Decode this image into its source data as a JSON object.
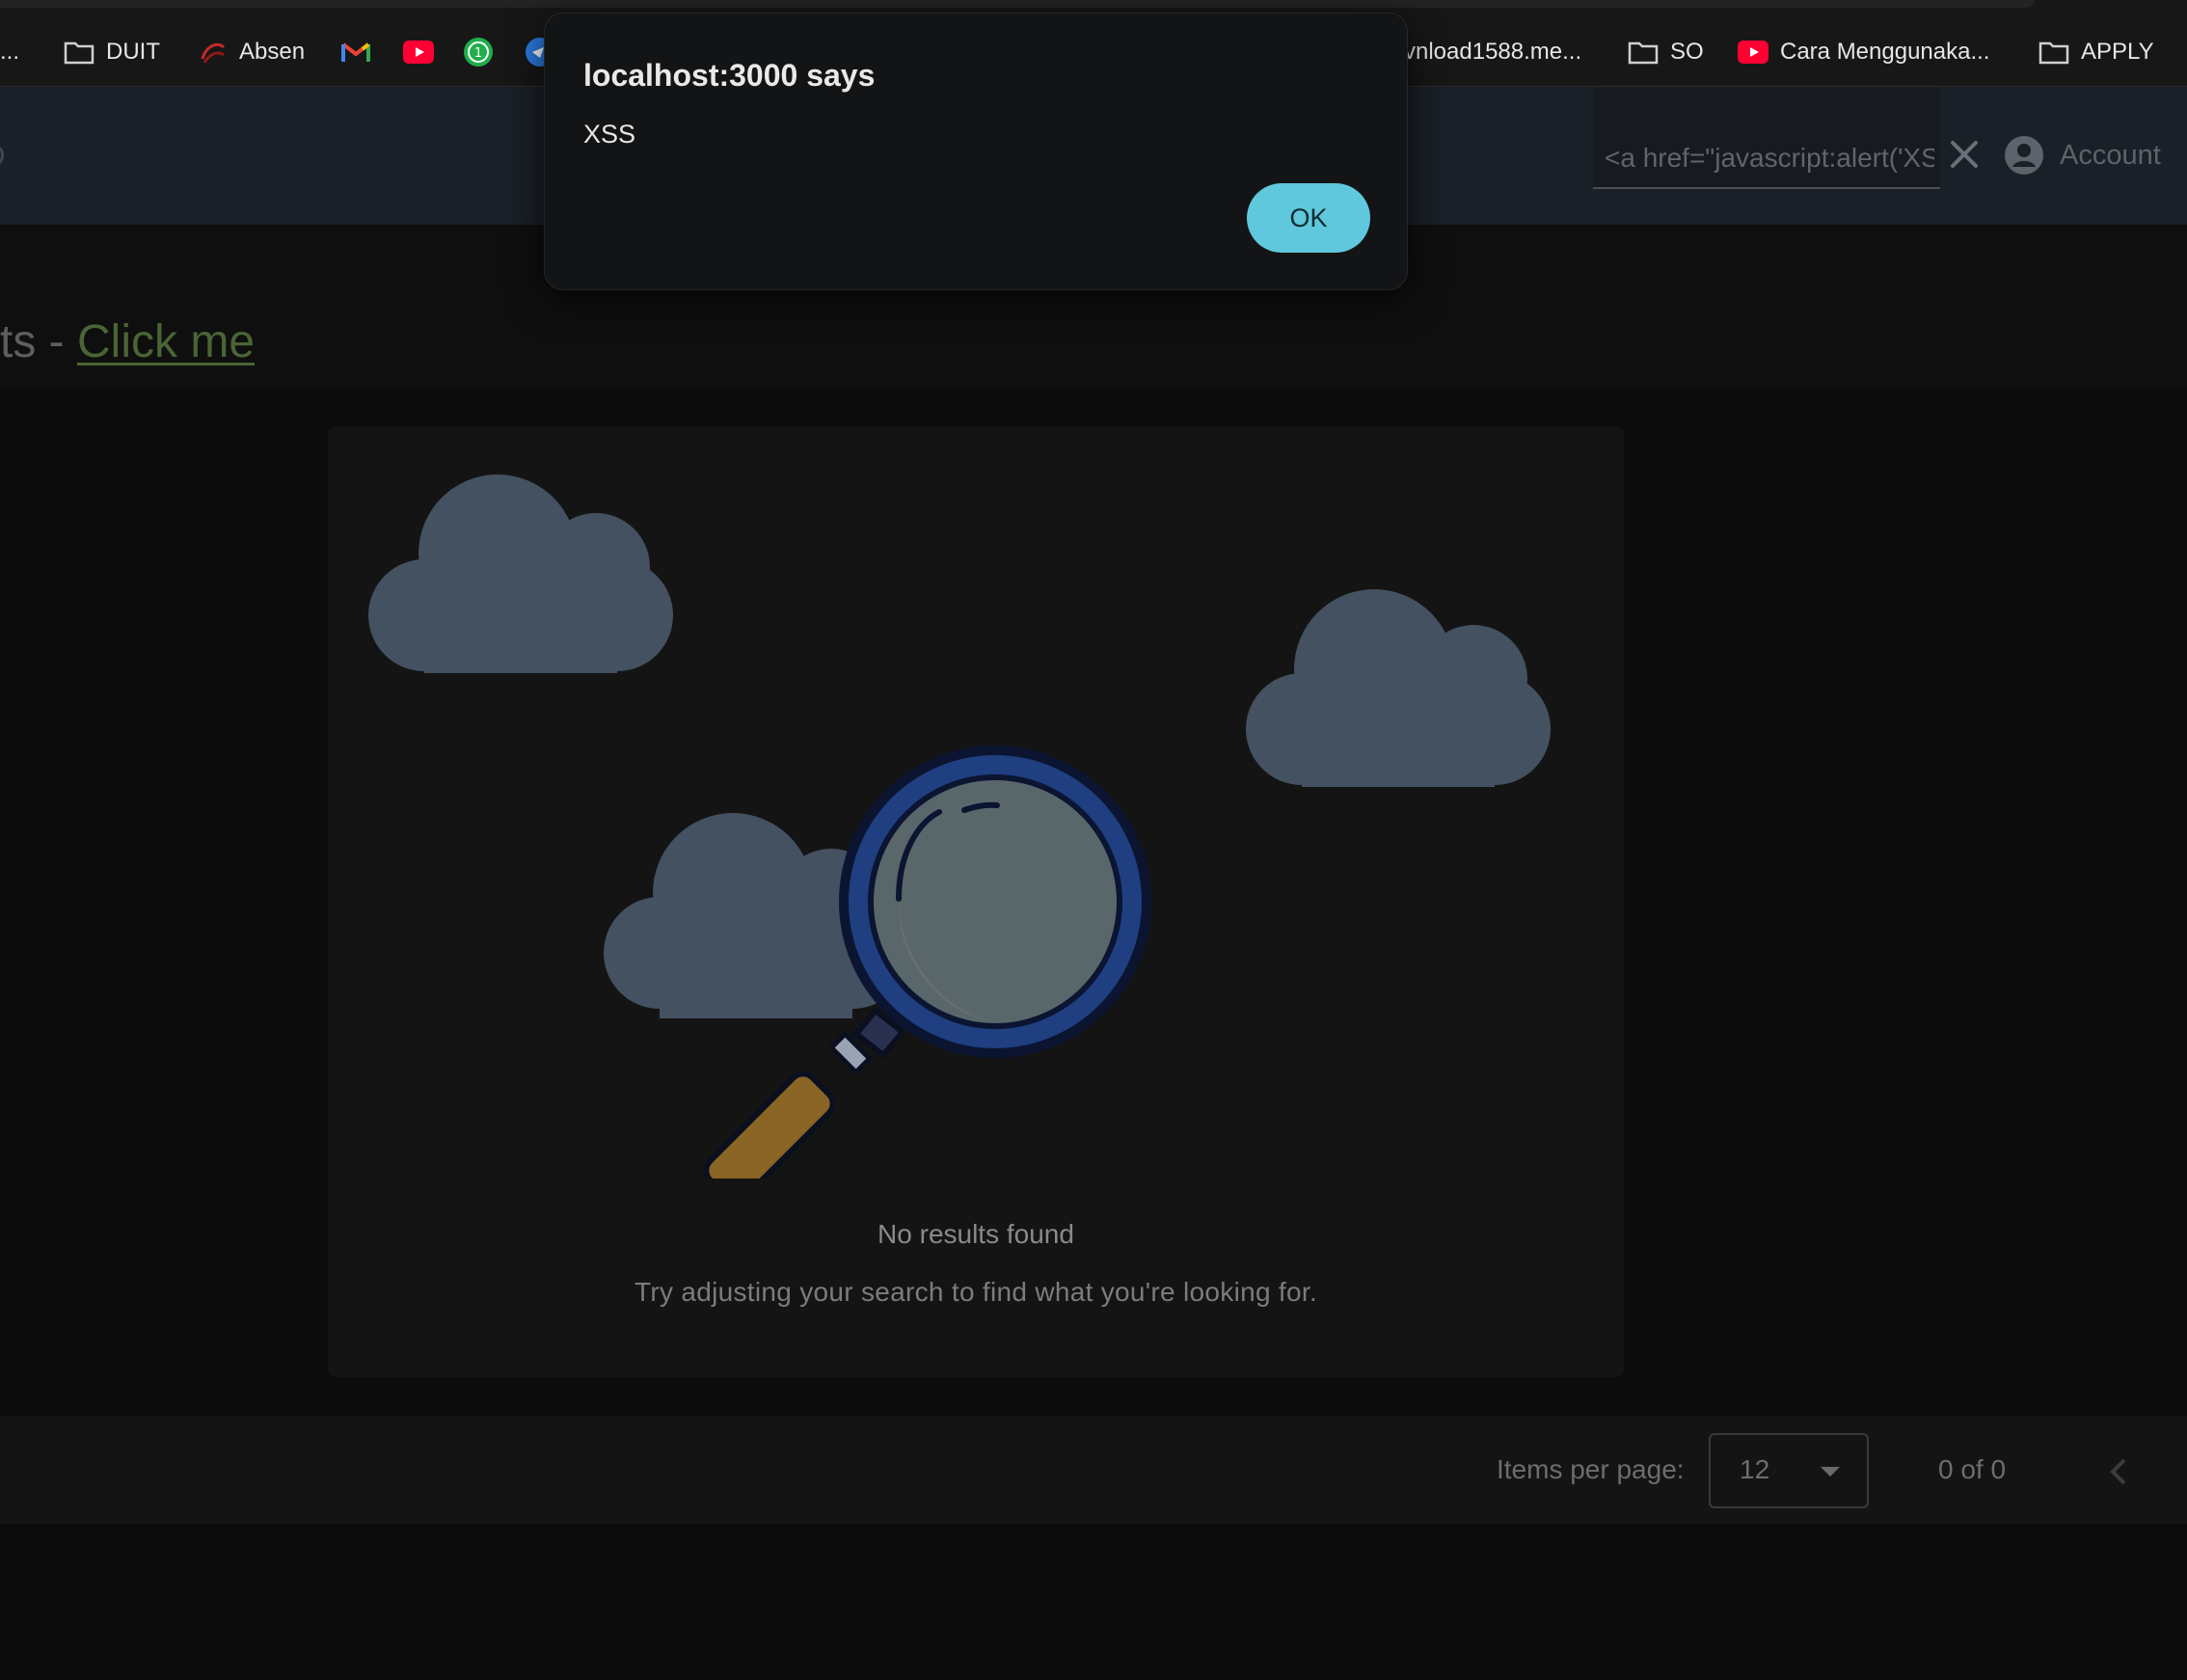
{
  "bookmarks": {
    "truncated_left": "...",
    "items": [
      {
        "label": "DUIT",
        "icon": "folder-icon"
      },
      {
        "label": "Absen",
        "icon": "absen-logo-icon"
      },
      {
        "label": "",
        "icon": "gmail-icon"
      },
      {
        "label": "",
        "icon": "youtube-icon"
      },
      {
        "label": "",
        "icon": "whatsapp-icon"
      },
      {
        "label": "",
        "icon": "telegram-icon"
      },
      {
        "label": "vnload1588.me...",
        "icon": ""
      },
      {
        "label": "SO",
        "icon": "folder-icon"
      },
      {
        "label": "Cara Menggunaka...",
        "icon": "youtube-icon"
      },
      {
        "label": "APPLY",
        "icon": "folder-icon"
      }
    ]
  },
  "header": {
    "search": {
      "value": "<a href=\"javascript:alert('XSS')\">Click me</a>",
      "placeholder": ""
    },
    "account_label": "Account"
  },
  "page": {
    "heading_prefix": "ts - ",
    "heading_link": "Click me"
  },
  "empty_state": {
    "title": "No results found",
    "subtitle": "Try adjusting your search to find what you're looking for."
  },
  "paginator": {
    "items_per_page_label": "Items per page:",
    "page_size": "12",
    "range_label": "0 of 0"
  },
  "alert": {
    "title": "localhost:3000 says",
    "message": "XSS",
    "ok_label": "OK"
  },
  "colors": {
    "accent": "#5fc8dc",
    "header_bg": "#1a2028",
    "link": "#4a6535",
    "cloud": "#435161",
    "lens_ring": "#1f3f80"
  }
}
